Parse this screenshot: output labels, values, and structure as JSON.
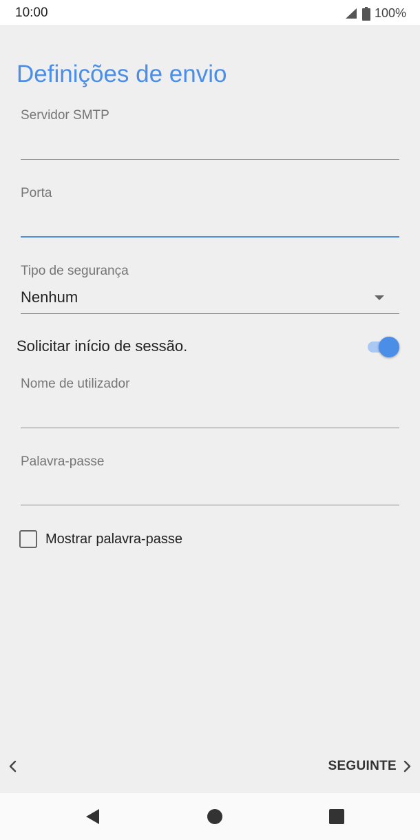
{
  "status_bar": {
    "time": "10:00",
    "battery_text": "100%",
    "icons": [
      "signal-icon",
      "battery-icon"
    ]
  },
  "page": {
    "title": "Definições de envio"
  },
  "form": {
    "smtp_server": {
      "label": "Servidor SMTP",
      "value": ""
    },
    "port": {
      "label": "Porta",
      "value": "",
      "focused": true
    },
    "security_type": {
      "label": "Tipo de segurança",
      "value": "Nenhum"
    },
    "require_signin": {
      "label": "Solicitar início de sessão.",
      "enabled": true
    },
    "username": {
      "label": "Nome de utilizador",
      "value": ""
    },
    "password": {
      "label": "Palavra-passe",
      "value": ""
    },
    "show_password": {
      "label": "Mostrar palavra-passe",
      "checked": false
    }
  },
  "navigation": {
    "back_icon": "chevron-left-icon",
    "next_label": "SEGUINTE",
    "next_icon": "chevron-right-icon"
  },
  "system_nav": {
    "buttons": [
      "back-triangle-icon",
      "home-circle-icon",
      "recents-square-icon"
    ]
  },
  "colors": {
    "accent": "#4a8ee8",
    "background": "#efefef",
    "toggle_track": "#a9c8f3"
  }
}
